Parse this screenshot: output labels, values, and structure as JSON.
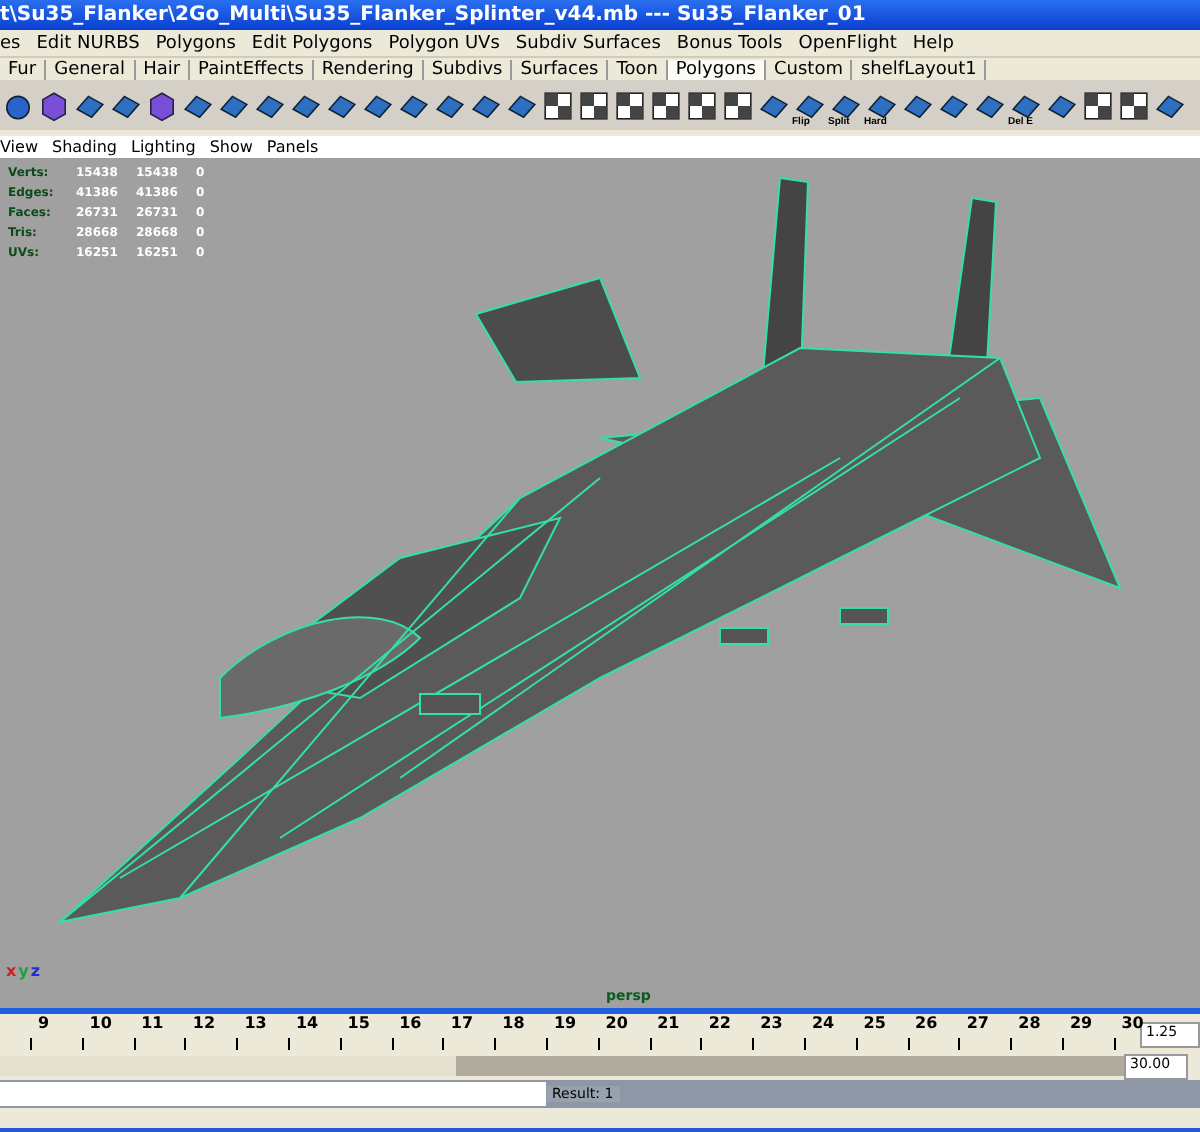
{
  "window": {
    "title": "t\\Su35_Flanker\\2Go_Multi\\Su35_Flanker_Splinter_v44.mb  ---  Su35_Flanker_01"
  },
  "menu": [
    "es",
    "Edit NURBS",
    "Polygons",
    "Edit Polygons",
    "Polygon UVs",
    "Subdiv Surfaces",
    "Bonus Tools",
    "OpenFlight",
    "Help"
  ],
  "shelf_tabs": [
    {
      "label": "Fur",
      "selected": false
    },
    {
      "label": "General",
      "selected": false
    },
    {
      "label": "Hair",
      "selected": false
    },
    {
      "label": "PaintEffects",
      "selected": false
    },
    {
      "label": "Rendering",
      "selected": false
    },
    {
      "label": "Subdivs",
      "selected": false
    },
    {
      "label": "Surfaces",
      "selected": false
    },
    {
      "label": "Toon",
      "selected": false
    },
    {
      "label": "Polygons",
      "selected": true
    },
    {
      "label": "Custom",
      "selected": false
    },
    {
      "label": "shelfLayout1",
      "selected": false
    }
  ],
  "shelf_icons": [
    {
      "kind": "sphere"
    },
    {
      "kind": "cube"
    },
    {
      "kind": "plane"
    },
    {
      "kind": "plane"
    },
    {
      "kind": "cube"
    },
    {
      "kind": "plane"
    },
    {
      "kind": "plane"
    },
    {
      "kind": "plane"
    },
    {
      "kind": "plane"
    },
    {
      "kind": "plane"
    },
    {
      "kind": "plane"
    },
    {
      "kind": "plane"
    },
    {
      "kind": "plane"
    },
    {
      "kind": "plane"
    },
    {
      "kind": "plane"
    },
    {
      "kind": "checker"
    },
    {
      "kind": "checker"
    },
    {
      "kind": "checker"
    },
    {
      "kind": "checker"
    },
    {
      "kind": "checker"
    },
    {
      "kind": "checker"
    },
    {
      "kind": "plane"
    },
    {
      "kind": "plane",
      "label": "Flip"
    },
    {
      "kind": "plane",
      "label": "Split"
    },
    {
      "kind": "plane",
      "label": "Hard"
    },
    {
      "kind": "plane"
    },
    {
      "kind": "plane"
    },
    {
      "kind": "plane"
    },
    {
      "kind": "plane",
      "label": "Del E"
    },
    {
      "kind": "plane"
    },
    {
      "kind": "checker"
    },
    {
      "kind": "checker"
    },
    {
      "kind": "plane"
    }
  ],
  "panel_menu": [
    "View",
    "Shading",
    "Lighting",
    "Show",
    "Panels"
  ],
  "stats": [
    {
      "label": "Verts:",
      "values": [
        "15438",
        "15438",
        "0"
      ]
    },
    {
      "label": "Edges:",
      "values": [
        "41386",
        "41386",
        "0"
      ]
    },
    {
      "label": "Faces:",
      "values": [
        "26731",
        "26731",
        "0"
      ]
    },
    {
      "label": "Tris:",
      "values": [
        "28668",
        "28668",
        "0"
      ]
    },
    {
      "label": "UVs:",
      "values": [
        "16251",
        "16251",
        "0"
      ]
    }
  ],
  "axes": [
    "x",
    "y",
    "z"
  ],
  "camera": "persp",
  "timeline": {
    "ticks": [
      "9",
      "10",
      "11",
      "12",
      "13",
      "14",
      "15",
      "16",
      "17",
      "18",
      "19",
      "20",
      "21",
      "22",
      "23",
      "24",
      "25",
      "26",
      "27",
      "28",
      "29",
      "30"
    ],
    "current_time": "1.25"
  },
  "range": {
    "end_value": "30.00"
  },
  "command_line": {
    "result": "Result: 1"
  }
}
